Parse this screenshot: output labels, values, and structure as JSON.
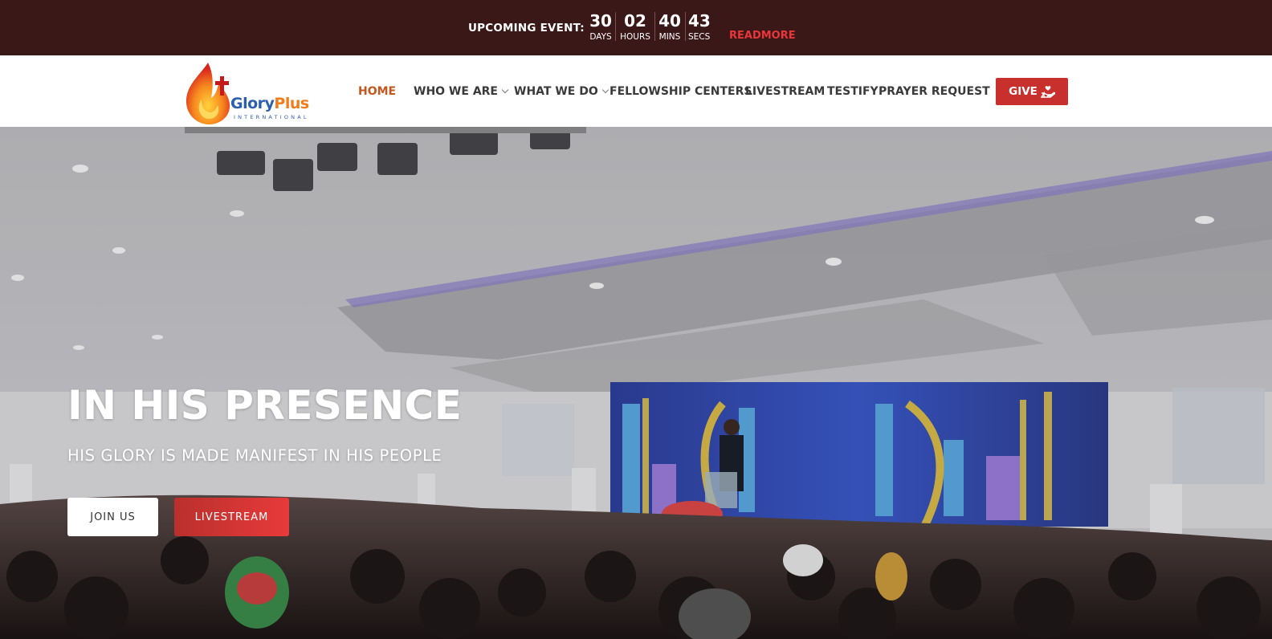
{
  "event_bar": {
    "label": "UPCOMING EVENT:",
    "countdown": [
      {
        "value": "30",
        "unit": "DAYS"
      },
      {
        "value": "02",
        "unit": "HOURS"
      },
      {
        "value": "40",
        "unit": "MINS"
      },
      {
        "value": "43",
        "unit": "SECS"
      }
    ],
    "readmore": "READMORE"
  },
  "logo": {
    "name_part1": "Glory",
    "name_part2": "Plus",
    "tagline": "INTERNATIONAL"
  },
  "nav": {
    "items": [
      {
        "label": "HOME",
        "active": true
      },
      {
        "label": "WHO WE ARE",
        "dropdown": true
      },
      {
        "label": "WHAT WE DO",
        "dropdown": true
      },
      {
        "label": "FELLOWSHIP CENTERS"
      },
      {
        "label": "LIVESTREAM"
      },
      {
        "label": "TESTIFY"
      },
      {
        "label": "PRAYER REQUEST"
      }
    ],
    "give_label": "GIVE",
    "give_icon": "hand-heart-icon"
  },
  "hero": {
    "title": "IN HIS PRESENCE",
    "subtitle": "HIS GLORY IS MADE MANIFEST IN HIS PEOPLE",
    "join_label": "JOIN US",
    "livestream_label": "LIVESTREAM"
  },
  "colors": {
    "topbar_bg": "#3a1818",
    "accent_red": "#c7302c",
    "readmore": "#e8363a",
    "nav_active": "#c2581f"
  }
}
